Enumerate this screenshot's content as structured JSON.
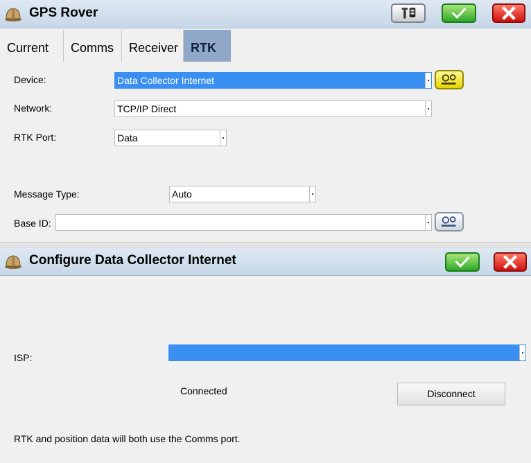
{
  "window": {
    "title": "GPS Rover",
    "icons": {
      "app": "hardhat-icon",
      "tool": "rod-receiver-icon",
      "ok": "checkmark-icon",
      "close": "close-icon"
    }
  },
  "tabs": [
    {
      "label": "Current",
      "active": false
    },
    {
      "label": "Comms",
      "active": false
    },
    {
      "label": "Receiver",
      "active": false
    },
    {
      "label": "RTK",
      "active": true
    }
  ],
  "form": {
    "device_label": "Device:",
    "device_value": "Data Collector Internet",
    "network_label": "Network:",
    "network_value": "TCP/IP Direct",
    "rtk_port_label": "RTK Port:",
    "rtk_port_value": "Data",
    "message_type_label": "Message Type:",
    "message_type_value": "Auto",
    "base_id_label": "Base ID:",
    "base_id_value": ""
  },
  "dialog": {
    "title": "Configure Data Collector Internet",
    "isp_label": "ISP:",
    "isp_value": "",
    "status": "Connected",
    "disconnect_label": "Disconnect",
    "footer_note": "RTK and position data will both use the Comms port."
  },
  "colors": {
    "accent_blue": "#3a8ff2",
    "active_tab": "#90a8c8",
    "ok_green": "#2ea82a",
    "close_red": "#d0120e",
    "config_yellow": "#e8d400"
  }
}
